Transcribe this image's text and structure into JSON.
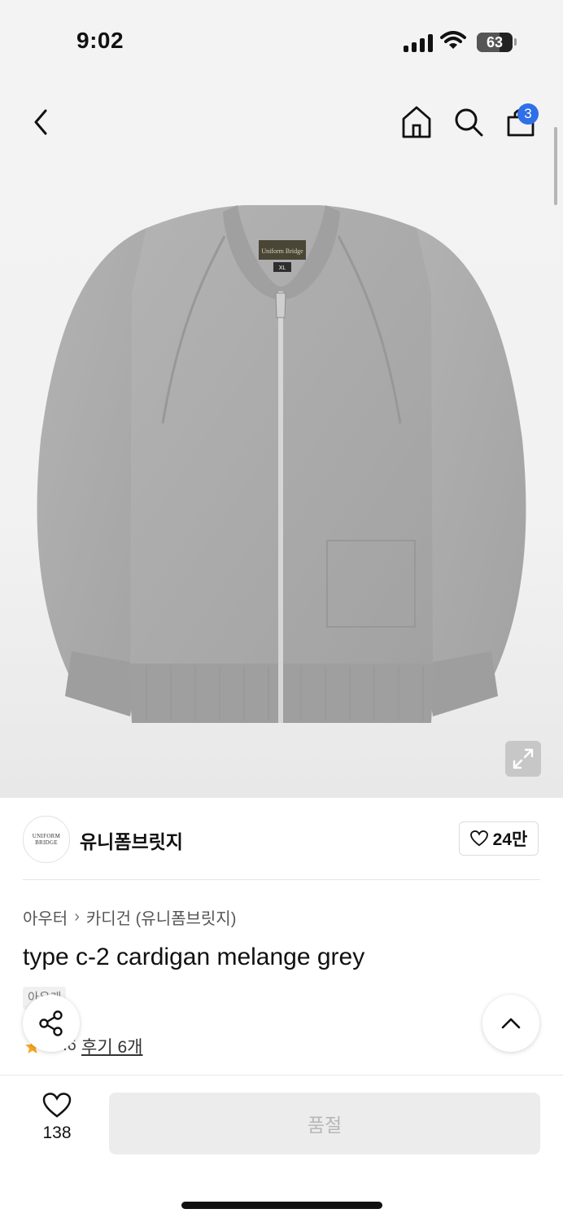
{
  "status_bar": {
    "time": "9:02",
    "battery": "63",
    "battery_level": 0.63
  },
  "header": {
    "cart_count": "3"
  },
  "icons": {
    "back": "chevron-left-icon",
    "home": "home-icon",
    "search": "search-icon",
    "cart": "shopping-bag-icon",
    "expand": "expand-icon",
    "share": "share-icon",
    "top": "chevron-up-icon",
    "wish": "heart-icon",
    "star": "star-icon"
  },
  "brand": {
    "name": "유니폼브릿지",
    "logo_text": "UNIFORM BRIDGE",
    "like_count": "24만"
  },
  "product": {
    "breadcrumb": [
      "아우터",
      "카디건 (유니폼브릿지)"
    ],
    "title": "type c-2 cardigan melange grey",
    "tag": "아우케",
    "rating": "4.6",
    "review_link": "후기 6개",
    "label_text": "Uniform Bridge",
    "label_size": "XL"
  },
  "bottom_bar": {
    "wish_count": "138",
    "soldout_label": "품절"
  },
  "colors": {
    "badge": "#2f6fe8",
    "star": "#f5a623",
    "garment": "#a9a9a9"
  }
}
